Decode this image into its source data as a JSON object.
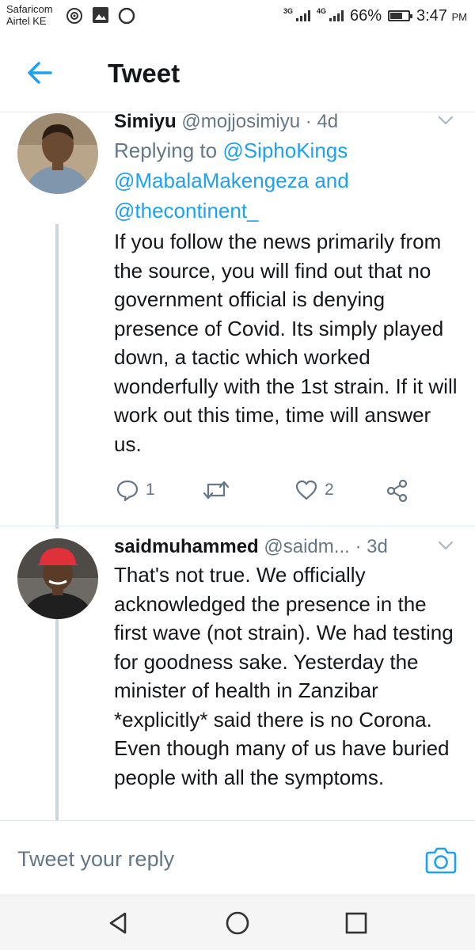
{
  "status_bar": {
    "carrier1": "Safaricom",
    "carrier2": "Airtel KE",
    "net1": "3G",
    "net2": "4G",
    "battery": "66%",
    "time": "3:47",
    "ampm": "PM"
  },
  "header": {
    "title": "Tweet",
    "back_icon": "arrow-left-icon"
  },
  "tweets": [
    {
      "name": "Simiyu",
      "handle": "@mojjosimiyu",
      "time": "4d",
      "replying_prefix": "Replying to ",
      "mentions": [
        "@SiphoKings",
        "@MabalaMakengeza",
        "@thecontinent_"
      ],
      "joiner": " and ",
      "text": "If you follow the news primarily from the source, you will find out that no government official is denying presence of Covid. Its simply played down, a tactic which worked wonderfully with the 1st strain. If it will work out this time, time will answer us.",
      "replies": "1",
      "retweets": "",
      "likes": "2"
    },
    {
      "name": "saidmuhammed",
      "handle": "@saidm...",
      "time": "3d",
      "text": "That's not true. We officially acknowledged the presence in the first wave (not strain). We had testing for goodness sake. Yesterday the minister of health in Zanzibar *explicitly* said there is no Corona. Even though many of us have buried people with all the symptoms."
    }
  ],
  "reply_bar": {
    "placeholder": "Tweet your reply",
    "camera_icon": "camera-icon"
  },
  "colors": {
    "accent": "#1da1f2",
    "secondary_text": "#657786",
    "primary_text": "#14171a"
  }
}
